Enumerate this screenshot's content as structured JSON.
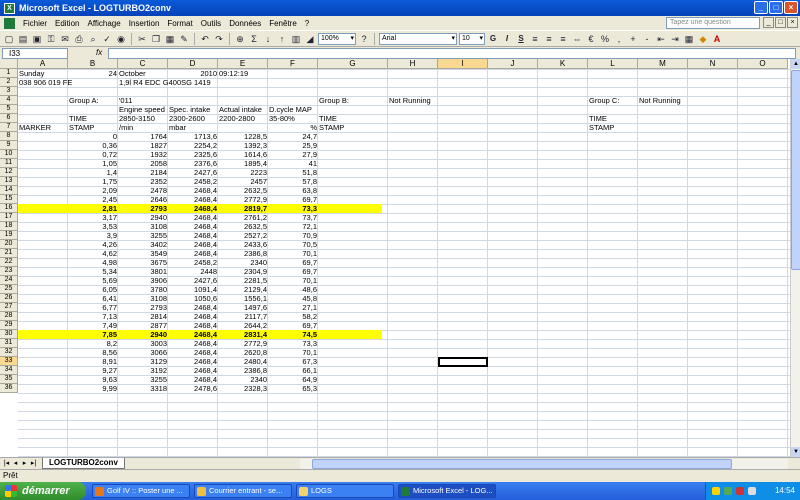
{
  "window": {
    "title": "Microsoft Excel - LOGTURBO2conv"
  },
  "menu": {
    "items": [
      "Fichier",
      "Edition",
      "Affichage",
      "Insertion",
      "Format",
      "Outils",
      "Données",
      "Fenêtre",
      "?"
    ],
    "help_placeholder": "Tapez une question"
  },
  "toolbar": {
    "zoom": "100%",
    "font": "Arial",
    "size": "10"
  },
  "formula": {
    "cell_ref": "I33",
    "fx": "fx",
    "content": ""
  },
  "columns": [
    "A",
    "B",
    "C",
    "D",
    "E",
    "F",
    "G",
    "H",
    "I",
    "J",
    "K",
    "L",
    "M",
    "N",
    "O"
  ],
  "rows": [
    "1",
    "2",
    "3",
    "4",
    "5",
    "6",
    "7",
    "8",
    "9",
    "10",
    "11",
    "12",
    "13",
    "14",
    "15",
    "16",
    "17",
    "18",
    "19",
    "20",
    "21",
    "22",
    "23",
    "24",
    "25",
    "26",
    "27",
    "28",
    "29",
    "30",
    "31",
    "32",
    "33",
    "34",
    "35",
    "36"
  ],
  "sheet": {
    "r1": {
      "a": "Sunday",
      "b": "24",
      "c": "October",
      "d": "2010",
      "e": "09:12:19"
    },
    "r2": {
      "a": "038 906 019 FE",
      "c": "1,9l R4 EDC G400SG  1419"
    },
    "r4": {
      "b": "Group A:",
      "c": "'011",
      "g": "Group B:",
      "h": "Not Running",
      "l": "Group C:",
      "m": "Not Running"
    },
    "r5": {
      "c": "Engine speed",
      "d": "Spec. intake",
      "e": "Actual intake",
      "f": "D.cycle MAP"
    },
    "r6": {
      "b": "TIME",
      "c": "2850-3150",
      "d": "2300-2600",
      "e": "2200-2800",
      "f": "35-80%",
      "g": "TIME",
      "l": "TIME"
    },
    "r7": {
      "a": "MARKER",
      "b": "STAMP",
      "c": "/min",
      "d": "mbar",
      "f": "%",
      "g": "STAMP",
      "l": "STAMP"
    },
    "data": [
      [
        "0",
        "1764",
        "1713,6",
        "1228,5",
        "24,7"
      ],
      [
        "0,36",
        "1827",
        "2254,2",
        "1392,3",
        "25,9"
      ],
      [
        "0,72",
        "1932",
        "2325,6",
        "1614,6",
        "27,9"
      ],
      [
        "1,05",
        "2058",
        "2376,6",
        "1895,4",
        "41"
      ],
      [
        "1,4",
        "2184",
        "2427,6",
        "2223",
        "51,8"
      ],
      [
        "1,75",
        "2352",
        "2458,2",
        "2457",
        "57,8"
      ],
      [
        "2,09",
        "2478",
        "2468,4",
        "2632,5",
        "63,8"
      ],
      [
        "2,45",
        "2646",
        "2468,4",
        "2772,9",
        "69,7"
      ],
      [
        "2,81",
        "2793",
        "2468,4",
        "2819,7",
        "73,3"
      ],
      [
        "3,17",
        "2940",
        "2468,4",
        "2761,2",
        "73,7"
      ],
      [
        "3,53",
        "3108",
        "2468,4",
        "2632,5",
        "72,1"
      ],
      [
        "3,9",
        "3255",
        "2468,4",
        "2527,2",
        "70,9"
      ],
      [
        "4,26",
        "3402",
        "2468,4",
        "2433,6",
        "70,5"
      ],
      [
        "4,62",
        "3549",
        "2468,4",
        "2386,8",
        "70,1"
      ],
      [
        "4,98",
        "3675",
        "2458,2",
        "2340",
        "69,7"
      ],
      [
        "5,34",
        "3801",
        "2448",
        "2304,9",
        "69,7"
      ],
      [
        "5,69",
        "3906",
        "2427,6",
        "2281,5",
        "70,1"
      ],
      [
        "6,05",
        "3780",
        "1091,4",
        "2129,4",
        "48,6"
      ],
      [
        "6,41",
        "3108",
        "1050,6",
        "1556,1",
        "45,8"
      ],
      [
        "6,77",
        "2793",
        "2468,4",
        "1497,6",
        "27,1"
      ],
      [
        "7,13",
        "2814",
        "2468,4",
        "2117,7",
        "58,2"
      ],
      [
        "7,49",
        "2877",
        "2468,4",
        "2644,2",
        "69,7"
      ],
      [
        "7,85",
        "2940",
        "2468,4",
        "2831,4",
        "74,5"
      ],
      [
        "8,2",
        "3003",
        "2468,4",
        "2772,9",
        "73,3"
      ],
      [
        "8,56",
        "3066",
        "2468,4",
        "2620,8",
        "70,1"
      ],
      [
        "8,91",
        "3129",
        "2468,4",
        "2480,4",
        "67,3"
      ],
      [
        "9,27",
        "3192",
        "2468,4",
        "2386,8",
        "66,1"
      ],
      [
        "9,63",
        "3255",
        "2468,4",
        "2340",
        "64,9"
      ],
      [
        "9,99",
        "3318",
        "2478,6",
        "2328,3",
        "65,3"
      ]
    ]
  },
  "tab": {
    "name": "LOGTURBO2conv"
  },
  "status": {
    "text": "Prêt"
  },
  "taskbar": {
    "start": "démarrer",
    "items": [
      "Golf IV :: Poster une ...",
      "Courrier entrant - se...",
      "LOGS",
      "Microsoft Excel - LOG..."
    ],
    "clock": "14:54"
  },
  "colors": {
    "highlight": "#ffff00",
    "titlebar": "#0a5ad8"
  }
}
